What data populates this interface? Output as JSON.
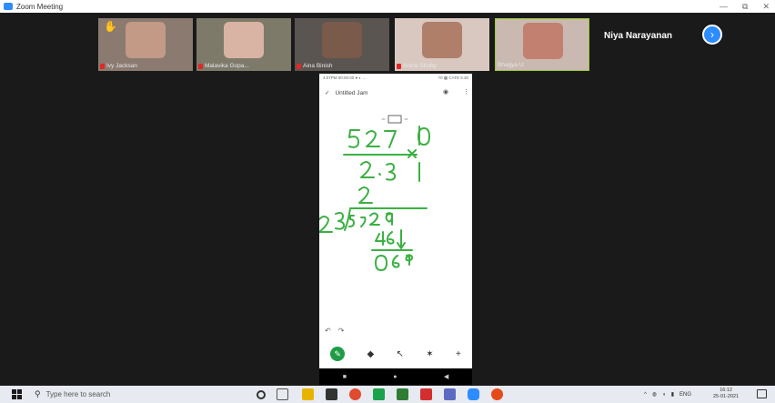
{
  "window": {
    "title": "Zoom Meeting",
    "min": "—",
    "restore": "⧉",
    "close": "✕"
  },
  "participants": [
    {
      "name": "Ivy Jacksan",
      "muted": true,
      "hand_raised": true,
      "bg": "#8a7a70",
      "face": "#c39a86"
    },
    {
      "name": "Malavika Gopa...",
      "muted": true,
      "bg": "#7d7a6a",
      "face": "#d9b3a4"
    },
    {
      "name": "Aina Binish",
      "muted": true,
      "bg": "#5a5550",
      "face": "#7a5a4a"
    },
    {
      "name": "Anina Shoby",
      "muted": true,
      "bg": "#d8c8c0",
      "face": "#b07f6a"
    },
    {
      "name": "Bhagya U",
      "muted": false,
      "bg": "#c9b9b0",
      "face": "#c28070",
      "active": true
    }
  ],
  "speaker": {
    "name": "Niya Narayanan"
  },
  "phone": {
    "status_left": "4:07PM 00:00:00 ● ◐ ...",
    "status_right": "70 ▦ CATE 5:30",
    "doc_title": "Untitled Jam",
    "handwriting_color": "#3cb043"
  },
  "taskbar": {
    "search_placeholder": "Type here to search",
    "lang": "ENG",
    "time": "16:12",
    "date": "25-01-2021"
  }
}
